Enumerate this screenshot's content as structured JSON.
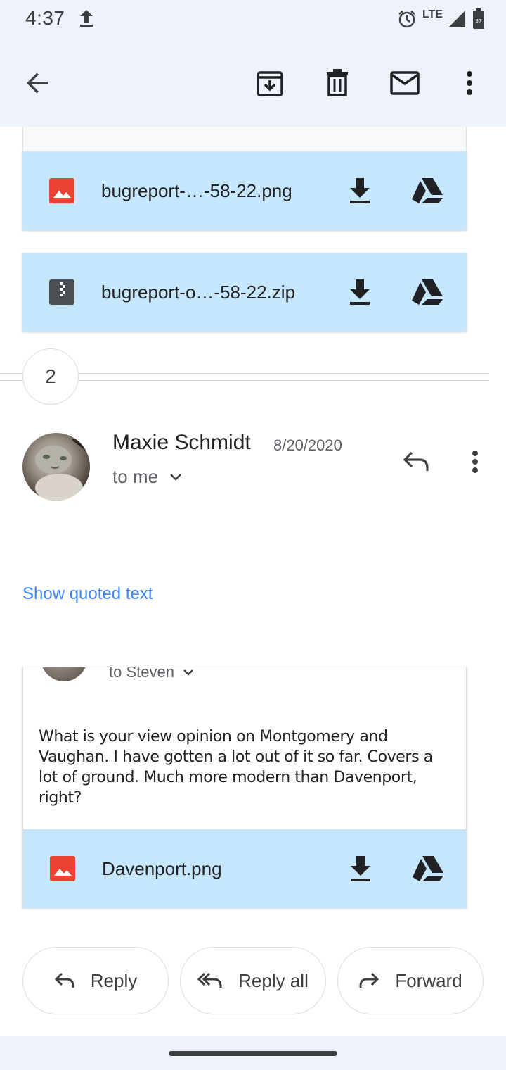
{
  "status_bar": {
    "time": "4:37",
    "network": "LTE"
  },
  "app_bar": {
    "back": "arrow-back-icon",
    "archive": "archive-icon",
    "delete": "delete-icon",
    "mark_unread": "mail-icon",
    "more": "more-vert-icon"
  },
  "attachments_top": [
    {
      "name": "bugreport-…-58-22.png",
      "type": "image"
    },
    {
      "name": "bugreport-o…-58-22.zip",
      "type": "zip"
    }
  ],
  "thread": {
    "collapsed_count": "2"
  },
  "message": {
    "sender": "Maxie Schmidt",
    "date": "8/20/2020",
    "recipient": "to me",
    "show_quoted": "Show quoted text"
  },
  "quoted": {
    "recipient": "to Steven",
    "body": "What is your view opinion on Montgomery and Vaughan. I have gotten a lot out of it so far. Covers a lot of ground. Much more modern than Davenport, right?",
    "attachment": {
      "name": "Davenport.png",
      "type": "image"
    }
  },
  "actions": {
    "reply": "Reply",
    "reply_all": "Reply all",
    "forward": "Forward"
  },
  "colors": {
    "attachment_bg": "#c6e6fb",
    "link": "#4285f4",
    "image_icon": "#ea4335",
    "bar_bg": "#eef2fb"
  }
}
